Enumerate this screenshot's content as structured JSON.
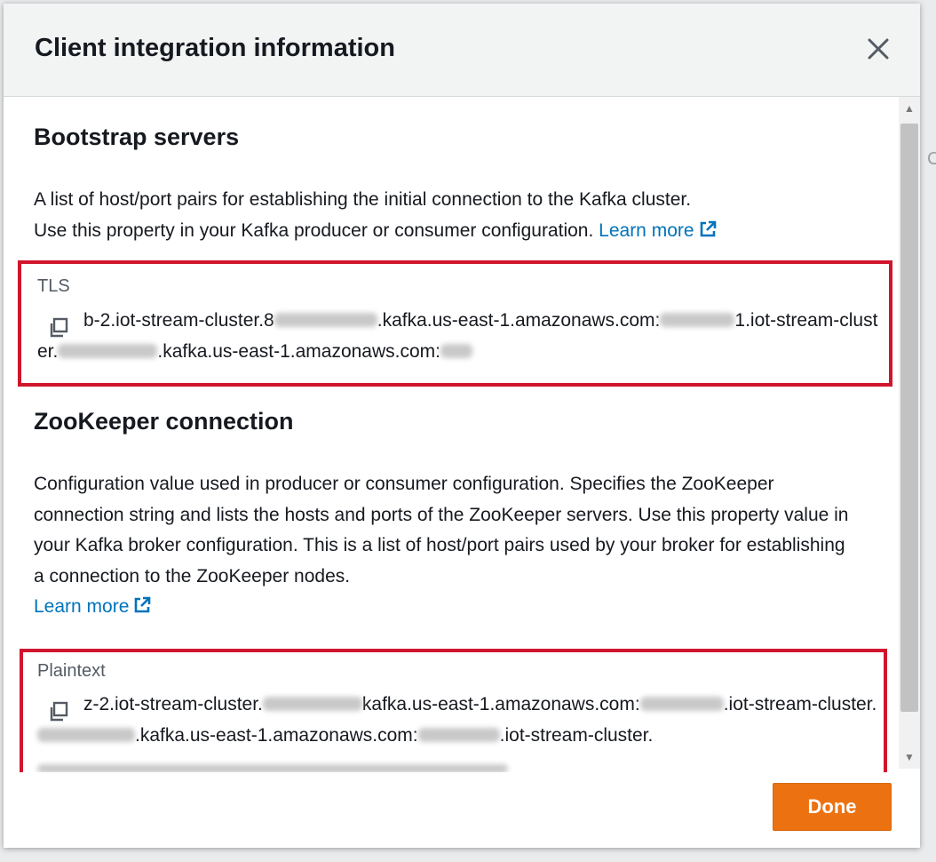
{
  "modal": {
    "title": "Client integration information",
    "close_icon": "close-icon",
    "done_label": "Done"
  },
  "bootstrap": {
    "title": "Bootstrap servers",
    "description_line1": "A list of host/port pairs for establishing the initial connection to the Kafka cluster.",
    "description_line2": "Use this property in your Kafka producer or consumer configuration.",
    "learn_more": "Learn more",
    "field_label": "TLS",
    "value_line1": [
      "b-2.iot-stream-cluster.8",
      ".kafka.us-east-1.amazonaws.com:",
      "1.iot-s"
    ],
    "value_line2": [
      "tream-cluster.",
      ".kafka.us-east-1.amazonaws.com:"
    ]
  },
  "zookeeper": {
    "title": "ZooKeeper connection",
    "description": "Configuration value used in producer or consumer configuration. Specifies the ZooKeeper connection string and lists the hosts and ports of the ZooKeeper servers. Use this property value in your Kafka broker configuration. This is a list of host/port pairs used by your broker for establishing a connection to the ZooKeeper nodes.",
    "learn_more": "Learn more",
    "field_label": "Plaintext",
    "value_line1": [
      "z-2.iot-stream-cluster.",
      "kafka.us-east-1.amazonaws.com:",
      ".iot-st"
    ],
    "value_line2": [
      "ream-cluster.",
      ".kafka.us-east-1.amazonaws.com:",
      ".iot-stream-cluster."
    ]
  },
  "colors": {
    "primary_button": "#ec7211",
    "link": "#0073bb",
    "highlight": "#d0152c"
  }
}
